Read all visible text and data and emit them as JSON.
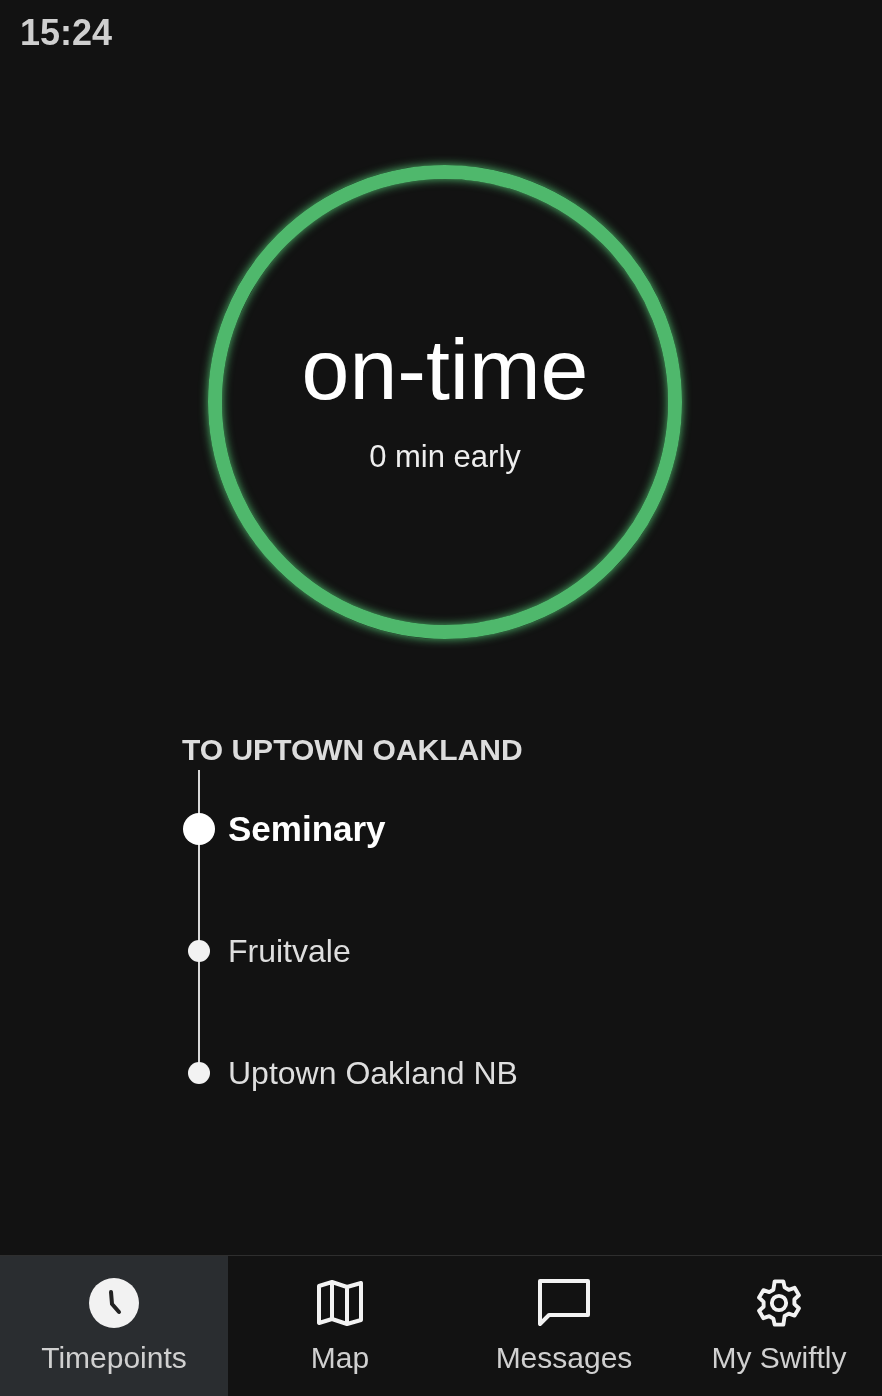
{
  "status_bar": {
    "time": "15:24"
  },
  "adherence": {
    "on_schedule": true,
    "title": "on-time",
    "detail": "0 min early"
  },
  "route": {
    "heading": "TO UPTOWN OAKLAND",
    "stops": [
      {
        "name": "Seminary",
        "current": true
      },
      {
        "name": "Fruitvale",
        "current": false
      },
      {
        "name": "Uptown Oakland NB",
        "current": false
      }
    ]
  },
  "nav": [
    {
      "kind": "clock",
      "label": "Timepoints",
      "selected": true
    },
    {
      "kind": "map",
      "label": "Map",
      "selected": false
    },
    {
      "kind": "message",
      "label": "Messages",
      "selected": false
    },
    {
      "kind": "gear",
      "label": "My Swiftly",
      "selected": false
    }
  ]
}
